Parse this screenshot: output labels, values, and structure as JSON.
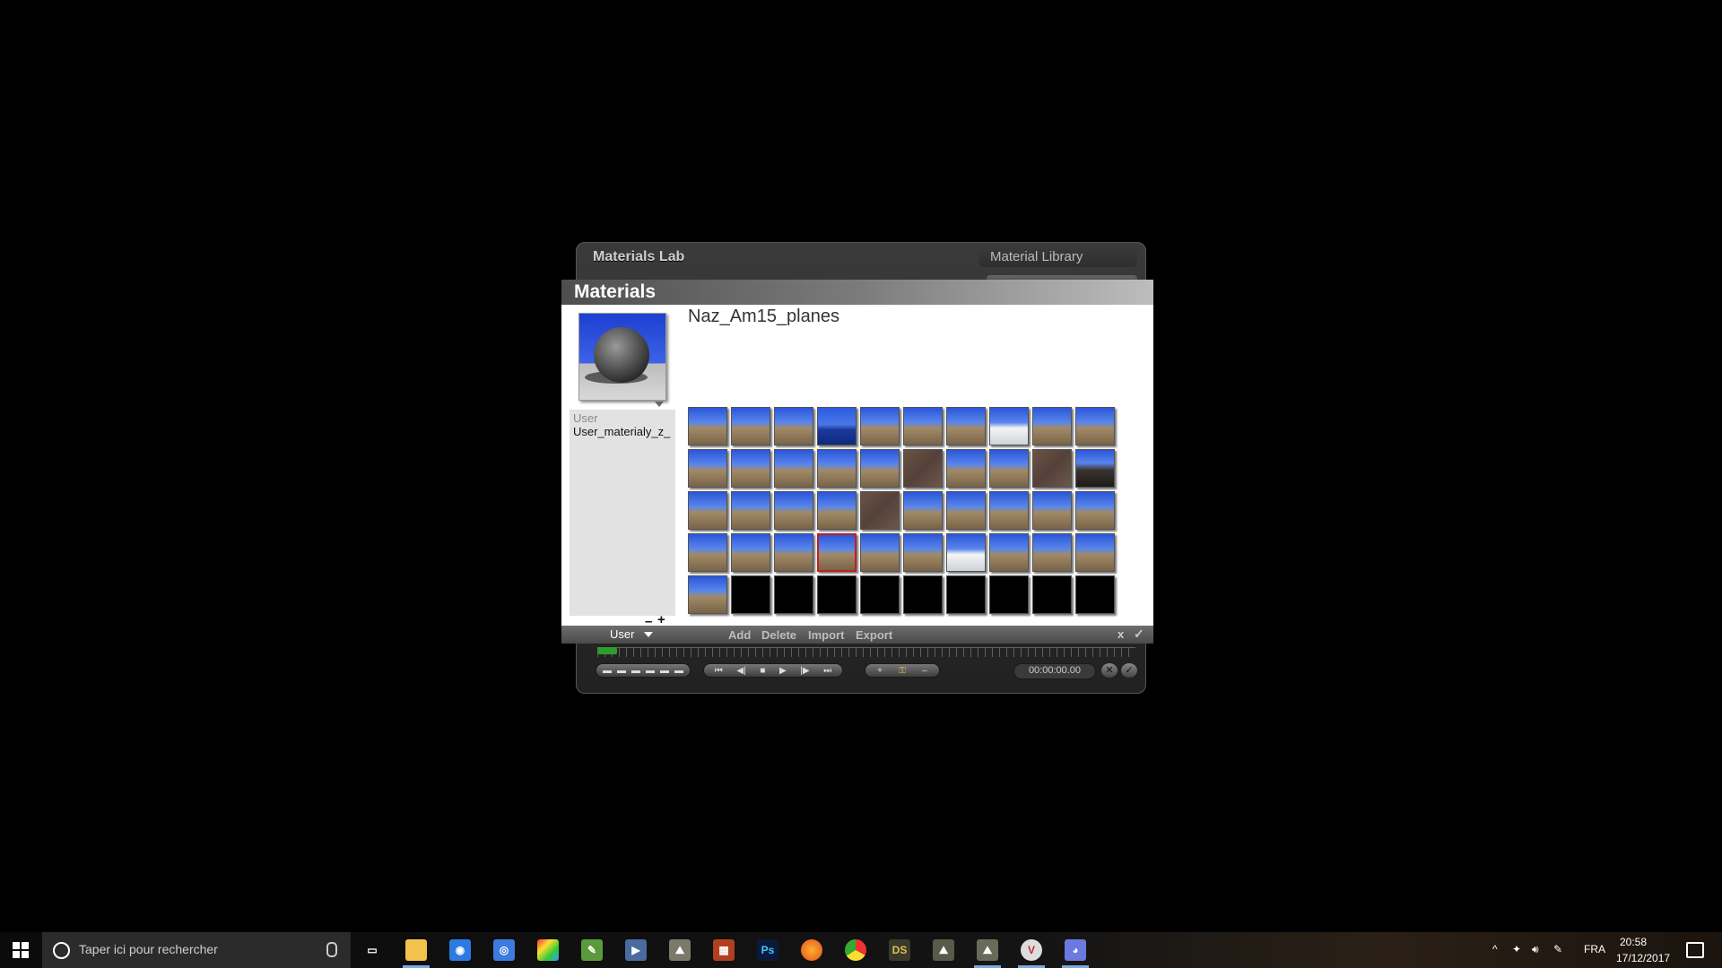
{
  "back_window": {
    "title": "Materials Lab",
    "library_tab": "Material Library",
    "transport": {
      "time": "00:00:00.00",
      "close_label": "✕",
      "ok_label": "✓"
    }
  },
  "materials": {
    "header": "Materials",
    "material_name": "Naz_Am15_planes",
    "side": {
      "category": "User",
      "item": "User_materialy_z_",
      "minus": "–",
      "plus": "+"
    },
    "tiles": [
      "sky-rock",
      "sky-rock",
      "sky-rock",
      "sea",
      "sky-rock",
      "sky-rock",
      "sky-rock",
      "sky-snow",
      "sky-rock",
      "sky-rock",
      "sky-rock",
      "sky-rock",
      "sky-rock",
      "sky-rock",
      "sky-rock",
      "ground",
      "sky-rock",
      "sky-rock",
      "ground",
      "sky-dark",
      "sky-rock",
      "sky-rock",
      "sky-rock",
      "sky-rock",
      "ground",
      "sky-rock",
      "sky-rock",
      "sky-rock",
      "sky-rock",
      "sky-rock",
      "sky-rock",
      "sky-rock",
      "sky-rock",
      "sky-rock",
      "sky-rock",
      "sky-rock",
      "sky-snow",
      "sky-rock",
      "sky-rock",
      "sky-rock",
      "sky-rock",
      "empty",
      "empty",
      "empty",
      "empty",
      "empty",
      "empty",
      "empty",
      "empty",
      "empty"
    ],
    "selected_tile_index": 33,
    "footer": {
      "category": "User",
      "add": "Add",
      "delete": "Delete",
      "import": "Import",
      "export": "Export",
      "close": "x",
      "ok": "✓"
    }
  },
  "taskbar": {
    "search_placeholder": "Taper ici pour rechercher",
    "apps": [
      {
        "icon": "task-view-icon"
      },
      {
        "icon": "file-explorer-icon"
      },
      {
        "icon": "app-icon-1"
      },
      {
        "icon": "app-icon-2"
      },
      {
        "icon": "app-icon-3"
      },
      {
        "icon": "app-icon-4"
      },
      {
        "icon": "media-icon"
      },
      {
        "icon": "terrain-app-icon"
      },
      {
        "icon": "app-icon-5"
      },
      {
        "icon": "photoshop-icon",
        "label": "Ps"
      },
      {
        "icon": "firefox-icon"
      },
      {
        "icon": "chrome-icon"
      },
      {
        "icon": "daz-studio-icon",
        "label": "DS"
      },
      {
        "icon": "bryce-icon"
      },
      {
        "icon": "bryce-active-icon"
      },
      {
        "icon": "vivaldi-icon"
      },
      {
        "icon": "discord-icon"
      }
    ],
    "tray": {
      "language": "FRA",
      "time": "20:58",
      "date": "17/12/2017"
    }
  }
}
